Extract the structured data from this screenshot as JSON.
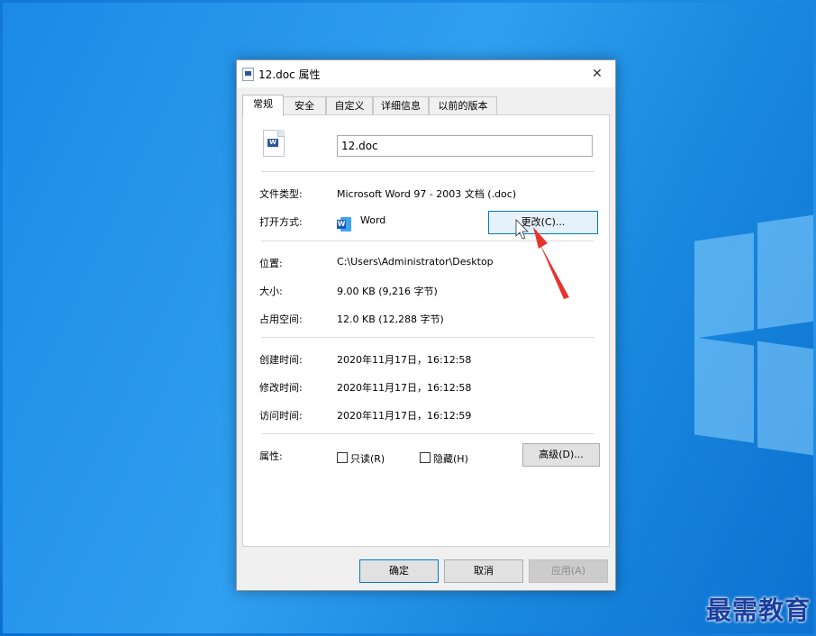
{
  "dialog": {
    "title": "12.doc 属性",
    "close_glyph": "✕"
  },
  "tabs": [
    {
      "label": "常规",
      "active": true
    },
    {
      "label": "安全",
      "active": false
    },
    {
      "label": "自定义",
      "active": false
    },
    {
      "label": "详细信息",
      "active": false
    },
    {
      "label": "以前的版本",
      "active": false
    }
  ],
  "general": {
    "file_name": "12.doc",
    "file_type_label": "文件类型:",
    "file_type_value": "Microsoft Word 97 - 2003 文档 (.doc)",
    "opens_with_label": "打开方式:",
    "opens_with_value": "Word",
    "change_button": "更改(C)...",
    "location_label": "位置:",
    "location_value": "C:\\Users\\Administrator\\Desktop",
    "size_label": "大小:",
    "size_value": "9.00 KB (9,216 字节)",
    "size_on_disk_label": "占用空间:",
    "size_on_disk_value": "12.0 KB (12,288 字节)",
    "created_label": "创建时间:",
    "created_value": "2020年11月17日，16:12:58",
    "modified_label": "修改时间:",
    "modified_value": "2020年11月17日，16:12:58",
    "accessed_label": "访问时间:",
    "accessed_value": "2020年11月17日，16:12:59",
    "attributes_label": "属性:",
    "readonly_label": "只读(R)",
    "hidden_label": "隐藏(H)",
    "advanced_button": "高级(D)..."
  },
  "footer": {
    "ok": "确定",
    "cancel": "取消",
    "apply": "应用(A)"
  },
  "watermark": "最需教育",
  "colors": {
    "desktop": "#1f8fe6",
    "accent": "#0078d7",
    "annotation_arrow": "#e8332d"
  }
}
